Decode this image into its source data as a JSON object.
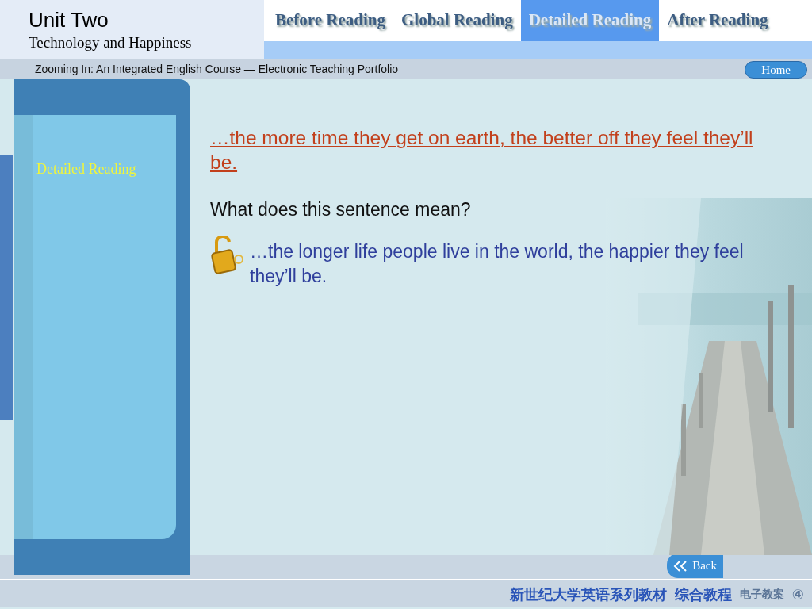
{
  "header": {
    "unit": "Unit Two",
    "subtitle": "Technology and Happiness"
  },
  "tabs": [
    {
      "label": "Before Reading",
      "selected": false
    },
    {
      "label": "Global Reading",
      "selected": false
    },
    {
      "label": "Detailed Reading",
      "selected": true
    },
    {
      "label": "After Reading",
      "selected": false
    }
  ],
  "course_bar": {
    "title": "Zooming In: An Integrated English Course — Electronic Teaching Portfolio",
    "home_button": "Home"
  },
  "sidebar": {
    "label": "Detailed Reading"
  },
  "content": {
    "quote": "…the more time they get on earth, the better off they feel they’ll be.",
    "question": "What does this sentence mean?",
    "answer": "…the longer life people live in the world, the happier they feel they’ll be."
  },
  "back_button": "Back",
  "footer": {
    "series": "新世纪大学英语系列教材",
    "book": "综合教程",
    "portfolio": "电子教案",
    "page": "④"
  }
}
